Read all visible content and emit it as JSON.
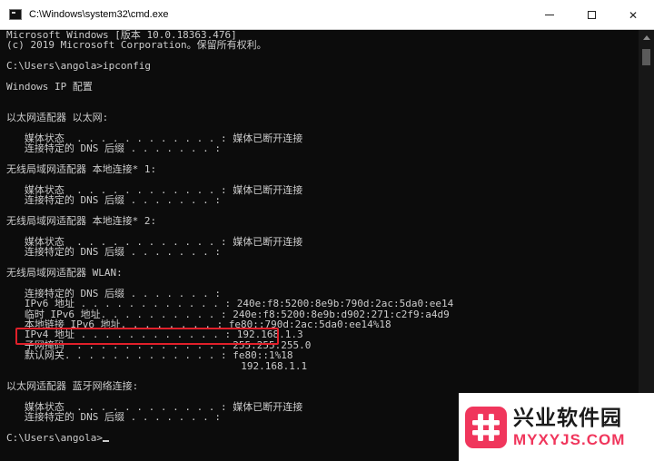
{
  "window": {
    "title": "C:\\Windows\\system32\\cmd.exe",
    "minimize_icon": "minimize-icon",
    "maximize_icon": "maximize-icon",
    "close_label": "✕"
  },
  "console": {
    "lines": [
      "Microsoft Windows [版本 10.0.18363.476]",
      "(c) 2019 Microsoft Corporation。保留所有权利。",
      "",
      "C:\\Users\\angola>ipconfig",
      "",
      "Windows IP 配置",
      "",
      "",
      "以太网适配器 以太网:",
      "",
      "   媒体状态  . . . . . . . . . . . . : 媒体已断开连接",
      "   连接特定的 DNS 后缀 . . . . . . . :",
      "",
      "无线局域网适配器 本地连接* 1:",
      "",
      "   媒体状态  . . . . . . . . . . . . : 媒体已断开连接",
      "   连接特定的 DNS 后缀 . . . . . . . :",
      "",
      "无线局域网适配器 本地连接* 2:",
      "",
      "   媒体状态  . . . . . . . . . . . . : 媒体已断开连接",
      "   连接特定的 DNS 后缀 . . . . . . . :",
      "",
      "无线局域网适配器 WLAN:",
      "",
      "   连接特定的 DNS 后缀 . . . . . . . :",
      "   IPv6 地址 . . . . . . . . . . . . : 240e:f8:5200:8e9b:790d:2ac:5da0:ee14",
      "   临时 IPv6 地址. . . . . . . . . . : 240e:f8:5200:8e9b:d902:271:c2f9:a4d9",
      "   本地链接 IPv6 地址. . . . . . . . : fe80::790d:2ac:5da0:ee14%18",
      "   IPv4 地址 . . . . . . . . . . . . : 192.168.1.3",
      "   子网掩码  . . . . . . . . . . . . : 255.255.255.0",
      "   默认网关. . . . . . . . . . . . . : fe80::1%18",
      "                                       192.168.1.1",
      "",
      "以太网适配器 蓝牙网络连接:",
      "",
      "   媒体状态  . . . . . . . . . . . . : 媒体已断开连接",
      "   连接特定的 DNS 后缀 . . . . . . . :",
      "",
      "C:\\Users\\angola>"
    ]
  },
  "watermark": {
    "name": "兴业软件园",
    "url": "MYXYJS.COM",
    "logo_color": "#f0365c"
  },
  "colors": {
    "console_bg": "#0c0c0c",
    "console_text": "#cccccc",
    "highlight_border": "#e0202a"
  }
}
